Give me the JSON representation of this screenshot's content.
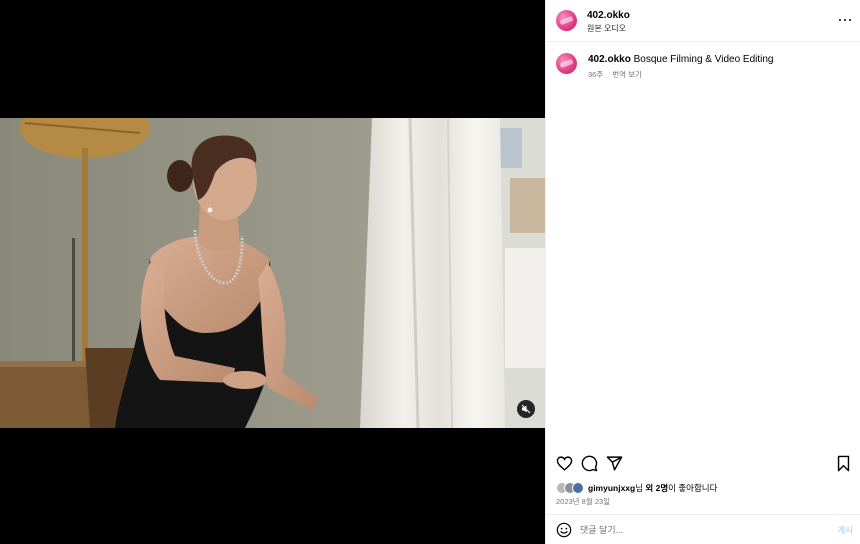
{
  "post": {
    "username": "402.okko",
    "audio_label": "원본 오디오",
    "caption_username": "402.okko",
    "caption_text": " Bosque Filming & Video Editing",
    "caption_age": "36주",
    "translate_label": "번역 보기"
  },
  "likes": {
    "liker": "gimyunjxxg",
    "suffix_1": "님 ",
    "others": "외 2명",
    "suffix_2": "이 좋아합니다"
  },
  "date": "2023년 8월 23일",
  "comment": {
    "placeholder": "댓글 달기...",
    "post_label": "게시"
  },
  "icons": {
    "more": "more-horizontal-icon",
    "like": "heart-icon",
    "comment": "comment-bubble-icon",
    "share": "paper-plane-icon",
    "save": "bookmark-icon",
    "mute": "speaker-muted-icon",
    "emoji": "smiley-icon"
  },
  "colors": {
    "avatar": "#e0418a",
    "muted_text": "#737373",
    "post_button": "#b3dbff",
    "divider": "#efefef"
  }
}
